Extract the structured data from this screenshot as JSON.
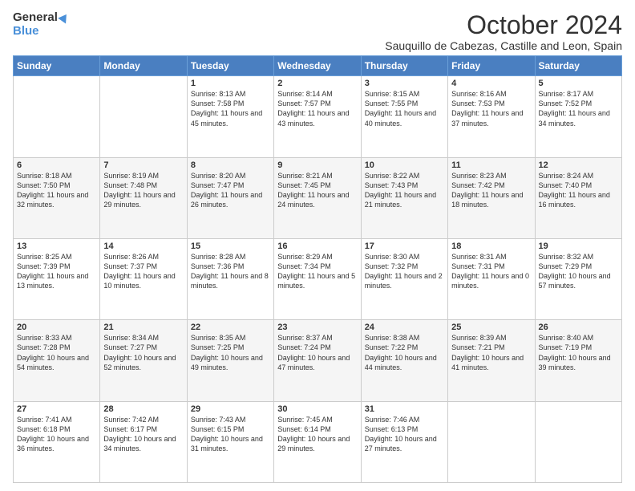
{
  "logo": {
    "general": "General",
    "blue": "Blue"
  },
  "header": {
    "month": "October 2024",
    "location": "Sauquillo de Cabezas, Castille and Leon, Spain"
  },
  "weekdays": [
    "Sunday",
    "Monday",
    "Tuesday",
    "Wednesday",
    "Thursday",
    "Friday",
    "Saturday"
  ],
  "weeks": [
    [
      {
        "day": "",
        "info": ""
      },
      {
        "day": "",
        "info": ""
      },
      {
        "day": "1",
        "info": "Sunrise: 8:13 AM\nSunset: 7:58 PM\nDaylight: 11 hours and 45 minutes."
      },
      {
        "day": "2",
        "info": "Sunrise: 8:14 AM\nSunset: 7:57 PM\nDaylight: 11 hours and 43 minutes."
      },
      {
        "day": "3",
        "info": "Sunrise: 8:15 AM\nSunset: 7:55 PM\nDaylight: 11 hours and 40 minutes."
      },
      {
        "day": "4",
        "info": "Sunrise: 8:16 AM\nSunset: 7:53 PM\nDaylight: 11 hours and 37 minutes."
      },
      {
        "day": "5",
        "info": "Sunrise: 8:17 AM\nSunset: 7:52 PM\nDaylight: 11 hours and 34 minutes."
      }
    ],
    [
      {
        "day": "6",
        "info": "Sunrise: 8:18 AM\nSunset: 7:50 PM\nDaylight: 11 hours and 32 minutes."
      },
      {
        "day": "7",
        "info": "Sunrise: 8:19 AM\nSunset: 7:48 PM\nDaylight: 11 hours and 29 minutes."
      },
      {
        "day": "8",
        "info": "Sunrise: 8:20 AM\nSunset: 7:47 PM\nDaylight: 11 hours and 26 minutes."
      },
      {
        "day": "9",
        "info": "Sunrise: 8:21 AM\nSunset: 7:45 PM\nDaylight: 11 hours and 24 minutes."
      },
      {
        "day": "10",
        "info": "Sunrise: 8:22 AM\nSunset: 7:43 PM\nDaylight: 11 hours and 21 minutes."
      },
      {
        "day": "11",
        "info": "Sunrise: 8:23 AM\nSunset: 7:42 PM\nDaylight: 11 hours and 18 minutes."
      },
      {
        "day": "12",
        "info": "Sunrise: 8:24 AM\nSunset: 7:40 PM\nDaylight: 11 hours and 16 minutes."
      }
    ],
    [
      {
        "day": "13",
        "info": "Sunrise: 8:25 AM\nSunset: 7:39 PM\nDaylight: 11 hours and 13 minutes."
      },
      {
        "day": "14",
        "info": "Sunrise: 8:26 AM\nSunset: 7:37 PM\nDaylight: 11 hours and 10 minutes."
      },
      {
        "day": "15",
        "info": "Sunrise: 8:28 AM\nSunset: 7:36 PM\nDaylight: 11 hours and 8 minutes."
      },
      {
        "day": "16",
        "info": "Sunrise: 8:29 AM\nSunset: 7:34 PM\nDaylight: 11 hours and 5 minutes."
      },
      {
        "day": "17",
        "info": "Sunrise: 8:30 AM\nSunset: 7:32 PM\nDaylight: 11 hours and 2 minutes."
      },
      {
        "day": "18",
        "info": "Sunrise: 8:31 AM\nSunset: 7:31 PM\nDaylight: 11 hours and 0 minutes."
      },
      {
        "day": "19",
        "info": "Sunrise: 8:32 AM\nSunset: 7:29 PM\nDaylight: 10 hours and 57 minutes."
      }
    ],
    [
      {
        "day": "20",
        "info": "Sunrise: 8:33 AM\nSunset: 7:28 PM\nDaylight: 10 hours and 54 minutes."
      },
      {
        "day": "21",
        "info": "Sunrise: 8:34 AM\nSunset: 7:27 PM\nDaylight: 10 hours and 52 minutes."
      },
      {
        "day": "22",
        "info": "Sunrise: 8:35 AM\nSunset: 7:25 PM\nDaylight: 10 hours and 49 minutes."
      },
      {
        "day": "23",
        "info": "Sunrise: 8:37 AM\nSunset: 7:24 PM\nDaylight: 10 hours and 47 minutes."
      },
      {
        "day": "24",
        "info": "Sunrise: 8:38 AM\nSunset: 7:22 PM\nDaylight: 10 hours and 44 minutes."
      },
      {
        "day": "25",
        "info": "Sunrise: 8:39 AM\nSunset: 7:21 PM\nDaylight: 10 hours and 41 minutes."
      },
      {
        "day": "26",
        "info": "Sunrise: 8:40 AM\nSunset: 7:19 PM\nDaylight: 10 hours and 39 minutes."
      }
    ],
    [
      {
        "day": "27",
        "info": "Sunrise: 7:41 AM\nSunset: 6:18 PM\nDaylight: 10 hours and 36 minutes."
      },
      {
        "day": "28",
        "info": "Sunrise: 7:42 AM\nSunset: 6:17 PM\nDaylight: 10 hours and 34 minutes."
      },
      {
        "day": "29",
        "info": "Sunrise: 7:43 AM\nSunset: 6:15 PM\nDaylight: 10 hours and 31 minutes."
      },
      {
        "day": "30",
        "info": "Sunrise: 7:45 AM\nSunset: 6:14 PM\nDaylight: 10 hours and 29 minutes."
      },
      {
        "day": "31",
        "info": "Sunrise: 7:46 AM\nSunset: 6:13 PM\nDaylight: 10 hours and 27 minutes."
      },
      {
        "day": "",
        "info": ""
      },
      {
        "day": "",
        "info": ""
      }
    ]
  ]
}
